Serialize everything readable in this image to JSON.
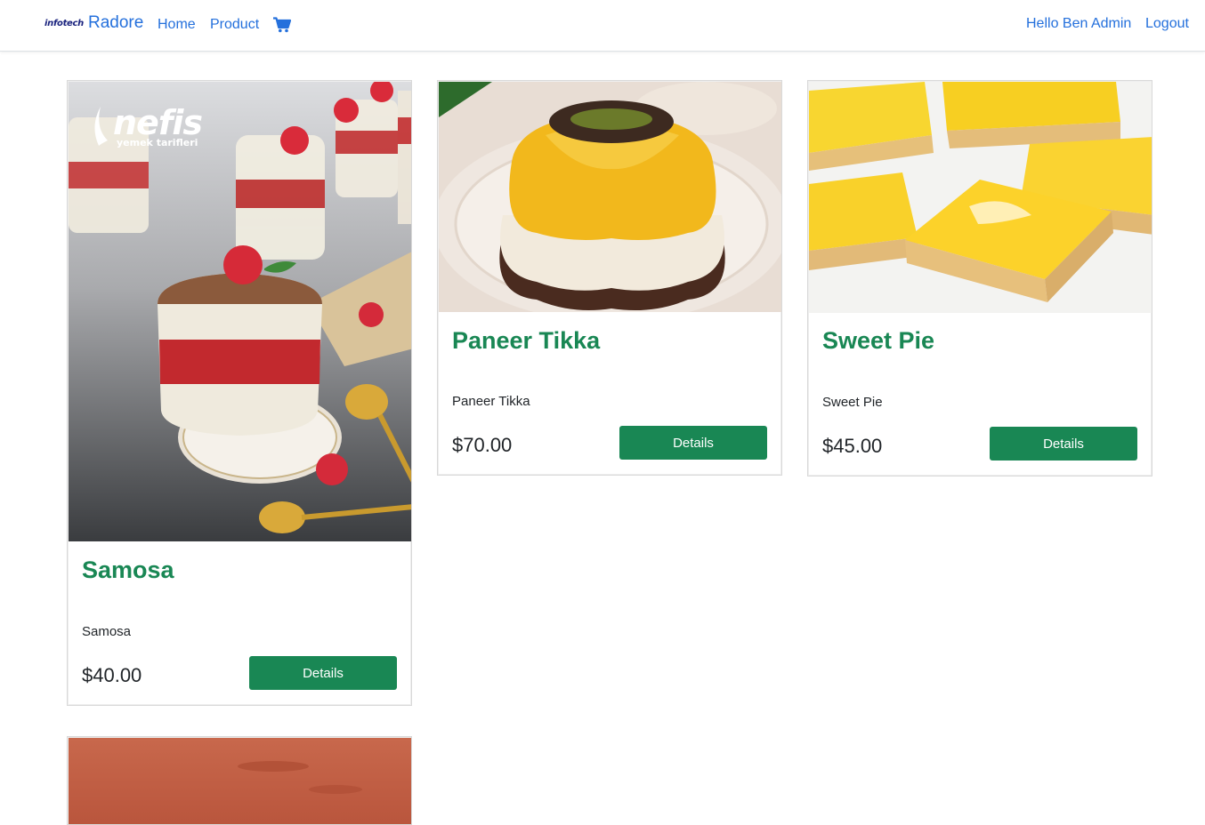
{
  "nav": {
    "brand_logo": "infotech",
    "brand_name": "Radore",
    "home": "Home",
    "product": "Product",
    "greeting": "Hello Ben Admin",
    "logout": "Logout"
  },
  "colors": {
    "link": "#2470dc",
    "accent": "#198754"
  },
  "products": [
    {
      "title": "Samosa",
      "description": "Samosa",
      "price": "$40.00",
      "button": "Details",
      "image_watermark": "nefis",
      "image_watermark_sub": "yemek tarifleri"
    },
    {
      "title": "Paneer Tikka",
      "description": "Paneer Tikka",
      "price": "$70.00",
      "button": "Details"
    },
    {
      "title": "Sweet Pie",
      "description": "Sweet Pie",
      "price": "$45.00",
      "button": "Details"
    }
  ]
}
